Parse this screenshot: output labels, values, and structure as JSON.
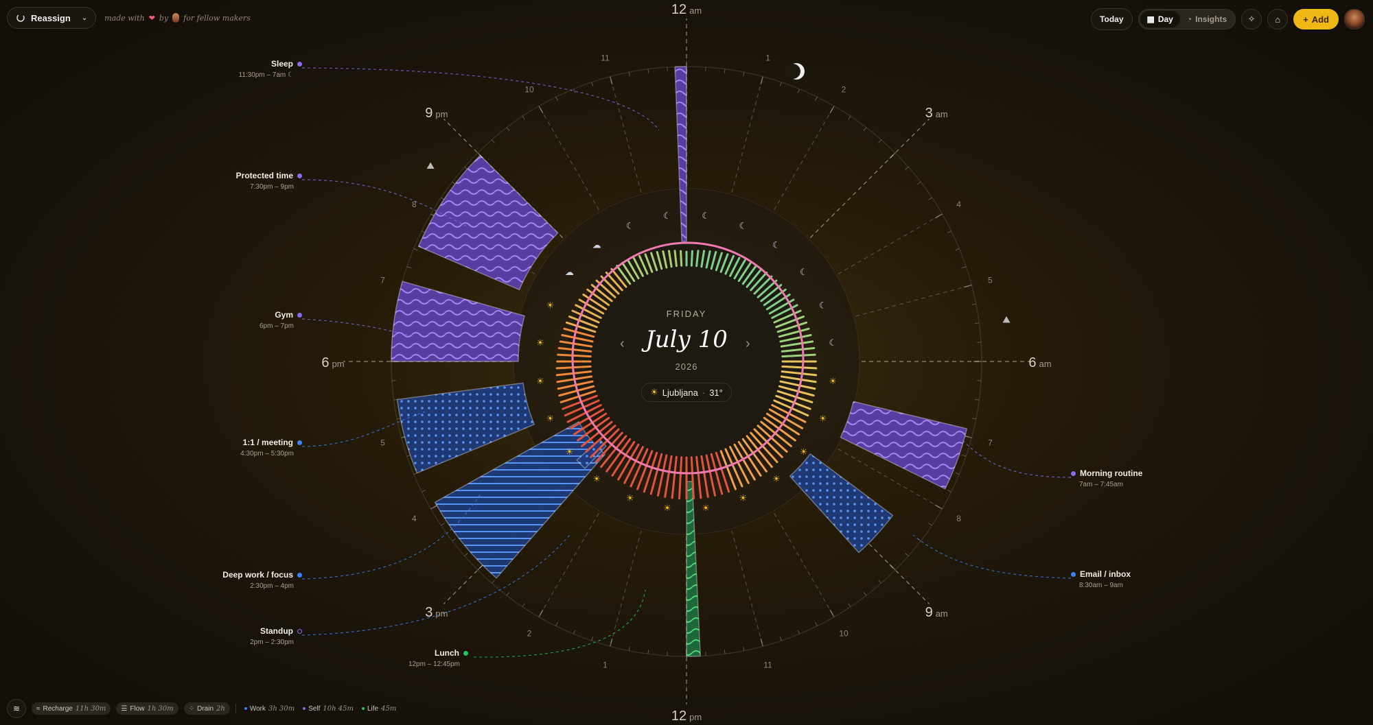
{
  "header": {
    "reassign_label": "Reassign",
    "made_with": "made with",
    "by": "by",
    "for_makers": "for fellow makers",
    "today_label": "Today",
    "day_label": "Day",
    "insights_label": "Insights",
    "add_label": "Add"
  },
  "center": {
    "weekday": "FRIDAY",
    "date": "July 10",
    "year": "2026",
    "city": "Ljubljana",
    "separator": "·",
    "temp": "31°"
  },
  "clock": {
    "major_labels": [
      {
        "num": "12",
        "suffix": "am"
      },
      {
        "num": "3",
        "suffix": "am"
      },
      {
        "num": "6",
        "suffix": "am"
      },
      {
        "num": "9",
        "suffix": "am"
      },
      {
        "num": "12",
        "suffix": "pm"
      },
      {
        "num": "3",
        "suffix": "pm"
      },
      {
        "num": "6",
        "suffix": "pm"
      },
      {
        "num": "9",
        "suffix": "pm"
      }
    ],
    "minor_labels": [
      "1",
      "2",
      "4",
      "5",
      "7",
      "8",
      "10",
      "11",
      "1",
      "2",
      "4",
      "5",
      "7",
      "8",
      "10",
      "11"
    ]
  },
  "events": [
    {
      "title": "Sleep",
      "range": "11:30pm – 7am",
      "color": "#8b6cf0",
      "has_moon": true
    },
    {
      "title": "Protected time",
      "range": "7:30pm – 9pm",
      "color": "#8b6cf0"
    },
    {
      "title": "Gym",
      "range": "6pm – 7pm",
      "color": "#8b6cf0"
    },
    {
      "title": "1:1 / meeting",
      "range": "4:30pm – 5:30pm",
      "color": "#3b82f6"
    },
    {
      "title": "Deep work / focus",
      "range": "2:30pm – 4pm",
      "color": "#3b82f6"
    },
    {
      "title": "Standup",
      "range": "2pm – 2:30pm",
      "color": "#8b6cf0"
    },
    {
      "title": "Lunch",
      "range": "12pm – 12:45pm",
      "color": "#22c55e"
    },
    {
      "title": "Morning routine",
      "range": "7am – 7:45am",
      "color": "#8b6cf0"
    },
    {
      "title": "Email / inbox",
      "range": "8:30am – 9am",
      "color": "#3b82f6"
    }
  ],
  "footer": {
    "recharge": {
      "label": "Recharge",
      "value": "11h 30m"
    },
    "flow": {
      "label": "Flow",
      "value": "1h 30m"
    },
    "drain": {
      "label": "Drain",
      "value": "2h"
    },
    "work": {
      "label": "Work",
      "value": "3h 30m",
      "color": "#3b82f6"
    },
    "self": {
      "label": "Self",
      "value": "10h 45m",
      "color": "#8b6cf0"
    },
    "life": {
      "label": "Life",
      "value": "45m",
      "color": "#22c55e"
    }
  }
}
